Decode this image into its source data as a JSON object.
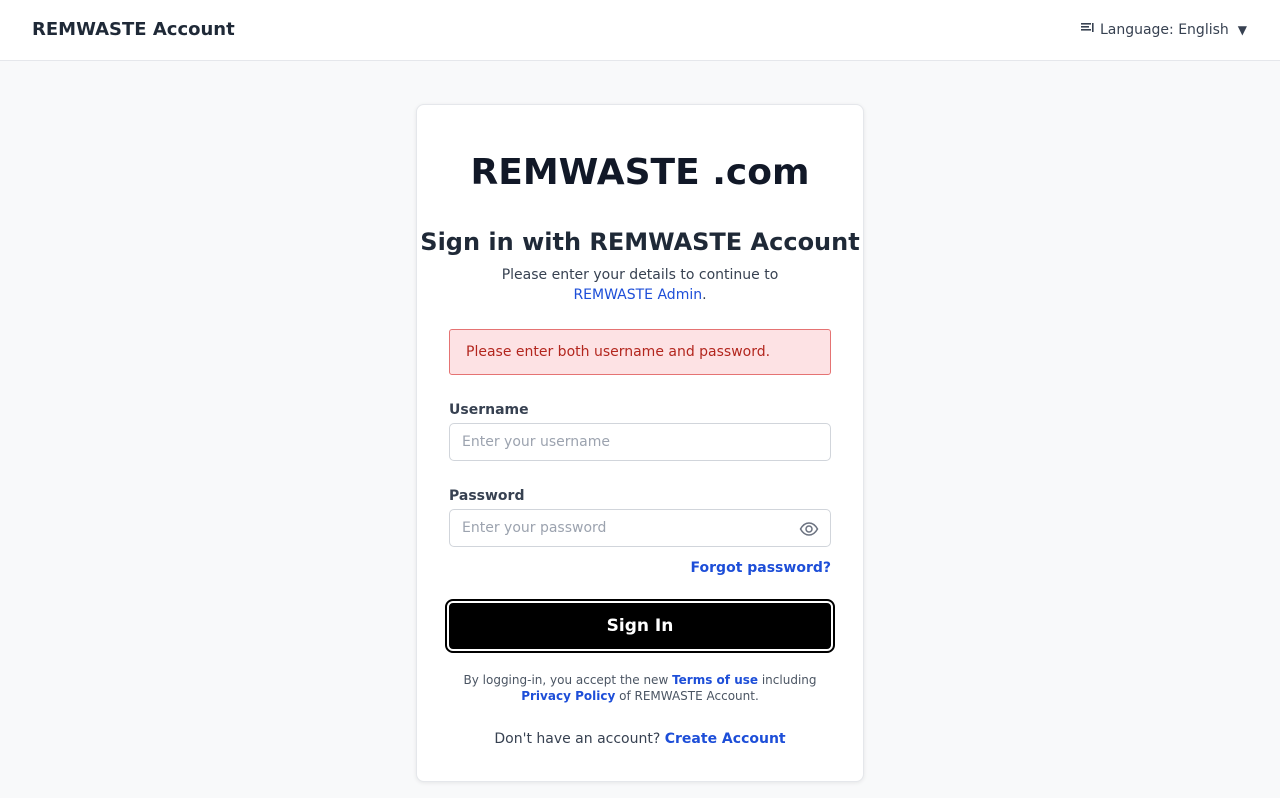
{
  "header": {
    "brand": "REMWASTE Account",
    "language_label": "Language: English",
    "language_icon": "language-icon",
    "caret": "▼"
  },
  "card": {
    "logo_text": "REMWASTE .com",
    "title": "Sign in with REMWASTE Account",
    "subtitle_prefix": "Please enter your details to continue to ",
    "subtitle_link": "REMWASTE Admin",
    "subtitle_suffix": ".",
    "error_message": "Please enter both username and password."
  },
  "form": {
    "username_label": "Username",
    "username_placeholder": "Enter your username",
    "username_value": "",
    "password_label": "Password",
    "password_placeholder": "Enter your password",
    "password_value": "",
    "show_password_icon": "eye-icon",
    "forgot_link": "Forgot password?",
    "submit_label": "Sign In"
  },
  "legal": {
    "prefix": "By logging-in, you accept the new ",
    "terms_link": "Terms of use",
    "middle": " including ",
    "privacy_link": "Privacy Policy",
    "suffix": " of REMWASTE Account."
  },
  "signup": {
    "prompt": "Don't have an account? ",
    "link": "Create Account"
  },
  "colors": {
    "link": "#1d4ed8",
    "error_bg": "#fde2e4",
    "error_border": "#e57373",
    "error_text": "#b3261e",
    "button_bg": "#000000"
  }
}
